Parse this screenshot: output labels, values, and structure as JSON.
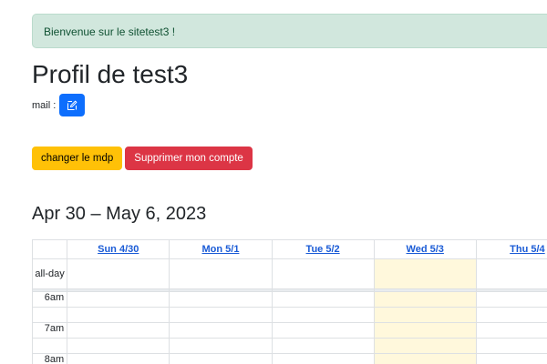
{
  "alert": {
    "text": "Bienvenue sur le sitetest3 !"
  },
  "profile": {
    "title": "Profil de test3",
    "mail_label": "mail :",
    "edit_icon": "edit-icon"
  },
  "actions": {
    "change_password": "changer le mdp",
    "delete_account": "Supprimer mon compte"
  },
  "calendar": {
    "title": "Apr 30 – May 6, 2023",
    "days": [
      {
        "label": "Sun 4/30",
        "today": false
      },
      {
        "label": "Mon 5/1",
        "today": false
      },
      {
        "label": "Tue 5/2",
        "today": false
      },
      {
        "label": "Wed 5/3",
        "today": true
      },
      {
        "label": "Thu 5/4",
        "today": false
      }
    ],
    "all_day_label": "all-day",
    "times": [
      "6am",
      "7am",
      "8am"
    ]
  },
  "colors": {
    "alert_bg": "#d1e7dd",
    "primary": "#0d6efd",
    "warning": "#ffc107",
    "danger": "#dc3545",
    "today_bg": "#fff8dc"
  }
}
